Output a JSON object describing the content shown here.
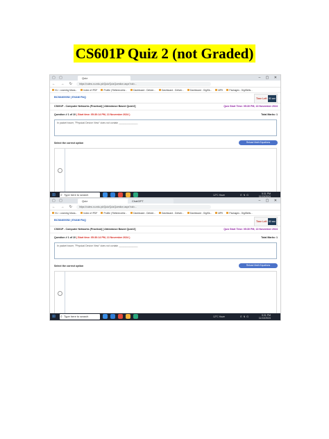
{
  "page": {
    "title": "CS601P Quiz 2 (not Graded)",
    "highlight_color": "#ffff00"
  },
  "screenshots": [
    {
      "tab_title": "Quiz",
      "tab2_title": "",
      "url": "https://vulms.vu.edu.pk/Quiz/QuizQuestion.aspx?cid=...",
      "bookmarks": [
        "VU - Learning Mana...",
        "Index of /PDF",
        "Profile | Referencefor...",
        "Dashboard - Deliver...",
        "Dashboard - Deliver...",
        "Dashboard - DigiSk...",
        "MPK",
        "Packages - DigiSkills..."
      ],
      "brand": "BCS6400052 | EXAM PAQ",
      "timer_label": "Time Left",
      "timer_value": "80 sec",
      "course": "CS601P - Computer Networks (Practical) [ Attendance Based Quiz#2]",
      "start_time": "Quiz Start Time: 05:30 PM, 13 November 2024",
      "question_no": "Question # 1 of 10",
      "question_start": "( Start time: 05:30:14 PM, 13 November 2024 )",
      "total_marks": "Total Marks: 1",
      "question_text": "In packet tracer, \"Physical Device View\" does not contain ______________",
      "select_label": "Select the correct option",
      "reload_label": "Reload Math Equations",
      "taskbar_search": "Type here to search",
      "weather": "12°C Haze",
      "lang": "ENG",
      "time": "5:31 PM",
      "date": "11/13/2024"
    },
    {
      "tab_title": "Quiz",
      "tab2_title": "ChatGPT",
      "url": "https://vulms.vu.edu.pk/Quiz/QuizQuestion.aspx?cid=...",
      "bookmarks": [
        "VU - Learning Mana...",
        "Index of /PDF",
        "Profile | Referencefor...",
        "Dashboard - Deliver...",
        "Dashboard - Deliver...",
        "Dashboard - DigiSk...",
        "MPK",
        "Packages - DigiSkills..."
      ],
      "brand": "BCS6400052 | EXAM PAQ",
      "timer_label": "Time Left",
      "timer_value": "80 sec",
      "course": "CS601P - Computer Networks (Practical) [ Attendance Based Quiz#2]",
      "start_time": "Quiz Start Time: 05:30 PM, 13 November 2024",
      "question_no": "Question # 1 of 10",
      "question_start": "( Start time: 05:30:14 PM, 13 November 2024 )",
      "total_marks": "Total Marks: 1",
      "question_text": "In packet tracer, \"Physical Device View\" does not contain ______________",
      "select_label": "Select the correct option",
      "reload_label": "Reload Math Equations",
      "taskbar_search": "Type here to search",
      "weather": "12°C Haze",
      "lang": "ENG",
      "time": "5:31 PM",
      "date": "11/13/2024"
    }
  ],
  "icons": {
    "nav": [
      "back-icon",
      "forward-icon",
      "refresh-icon"
    ],
    "taskbar": [
      "windows-start-icon",
      "search-icon",
      "edge-icon",
      "vscode-icon",
      "chrome-icon",
      "explorer-icon",
      "store-icon"
    ]
  }
}
